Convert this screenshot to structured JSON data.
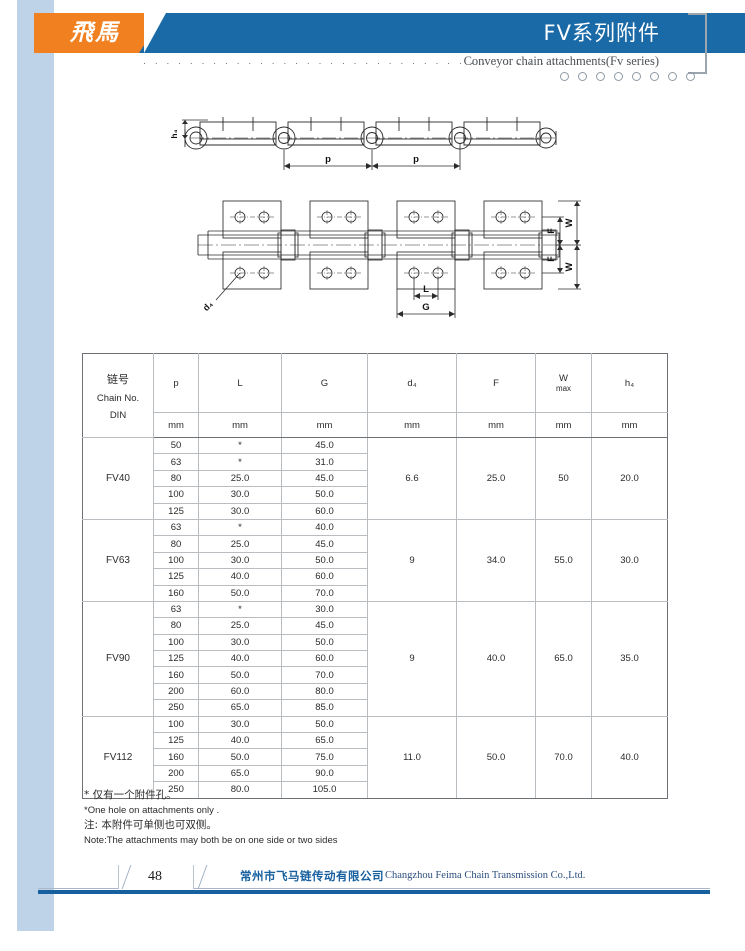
{
  "header": {
    "logo_text": "飛馬",
    "title": "FV系列附件",
    "subtitle": "Conveyor chain attachments(Fv series)",
    "dots": "· · · · · · · · · · · · · · · · · · · · · · · · · · · · · · · · · · · · · · · · ·",
    "circle_count": 8,
    "blue": "#1a6aa8",
    "orange": "#f08020"
  },
  "drawings": {
    "top": {
      "name": "chain-side-view",
      "labels": {
        "h4": "h₄",
        "pitch_1": "p",
        "pitch_2": "p"
      }
    },
    "bottom": {
      "name": "chain-plan-view",
      "labels": {
        "d4": "d₄",
        "L": "L",
        "G": "G",
        "F_top": "F",
        "F_bottom": "F",
        "W_top": "W",
        "W_bottom": "W"
      }
    }
  },
  "table": {
    "headers": {
      "chain_cn": "链号",
      "chain_en": "Chain No.",
      "chain_din": "DIN",
      "p": "p",
      "L": "L",
      "G": "G",
      "d4": "d₄",
      "F": "F",
      "W": "W",
      "W_sub": "max",
      "h4": "h₄"
    },
    "units": [
      "mm",
      "mm",
      "mm",
      "mm",
      "mm",
      "mm",
      "mm",
      "mm"
    ],
    "groups": [
      {
        "name": "FV40",
        "d4": "6.6",
        "F": "25.0",
        "W": "50",
        "h4": "20.0",
        "rows": [
          {
            "p": "50",
            "L": "*",
            "G": "45.0"
          },
          {
            "p": "63",
            "L": "*",
            "G": "31.0"
          },
          {
            "p": "80",
            "L": "25.0",
            "G": "45.0"
          },
          {
            "p": "100",
            "L": "30.0",
            "G": "50.0"
          },
          {
            "p": "125",
            "L": "30.0",
            "G": "60.0"
          }
        ]
      },
      {
        "name": "FV63",
        "d4": "9",
        "F": "34.0",
        "W": "55.0",
        "h4": "30.0",
        "rows": [
          {
            "p": "63",
            "L": "*",
            "G": "40.0"
          },
          {
            "p": "80",
            "L": "25.0",
            "G": "45.0"
          },
          {
            "p": "100",
            "L": "30.0",
            "G": "50.0"
          },
          {
            "p": "125",
            "L": "40.0",
            "G": "60.0"
          },
          {
            "p": "160",
            "L": "50.0",
            "G": "70.0"
          }
        ]
      },
      {
        "name": "FV90",
        "d4": "9",
        "F": "40.0",
        "W": "65.0",
        "h4": "35.0",
        "rows": [
          {
            "p": "63",
            "L": "*",
            "G": "30.0"
          },
          {
            "p": "80",
            "L": "25.0",
            "G": "45.0"
          },
          {
            "p": "100",
            "L": "30.0",
            "G": "50.0"
          },
          {
            "p": "125",
            "L": "40.0",
            "G": "60.0"
          },
          {
            "p": "160",
            "L": "50.0",
            "G": "70.0"
          },
          {
            "p": "200",
            "L": "60.0",
            "G": "80.0"
          },
          {
            "p": "250",
            "L": "65.0",
            "G": "85.0"
          }
        ]
      },
      {
        "name": "FV112",
        "d4": "11.0",
        "F": "50.0",
        "W": "70.0",
        "h4": "40.0",
        "rows": [
          {
            "p": "100",
            "L": "30.0",
            "G": "50.0"
          },
          {
            "p": "125",
            "L": "40.0",
            "G": "65.0"
          },
          {
            "p": "160",
            "L": "50.0",
            "G": "75.0"
          },
          {
            "p": "200",
            "L": "65.0",
            "G": "90.0"
          },
          {
            "p": "250",
            "L": "80.0",
            "G": "105.0"
          }
        ]
      }
    ]
  },
  "notes": [
    "* 仅有一个附件孔。",
    "*One hole on attachments only .",
    "注: 本附件可单侧也可双侧。",
    "Note:The attachments may both be on one side or two sides"
  ],
  "footer": {
    "page_number": "48",
    "company_cn": "常州市飞马链传动有限公司",
    "company_en": "Changzhou Feima Chain Transmission Co.,Ltd.",
    "accent": "#17609f"
  }
}
